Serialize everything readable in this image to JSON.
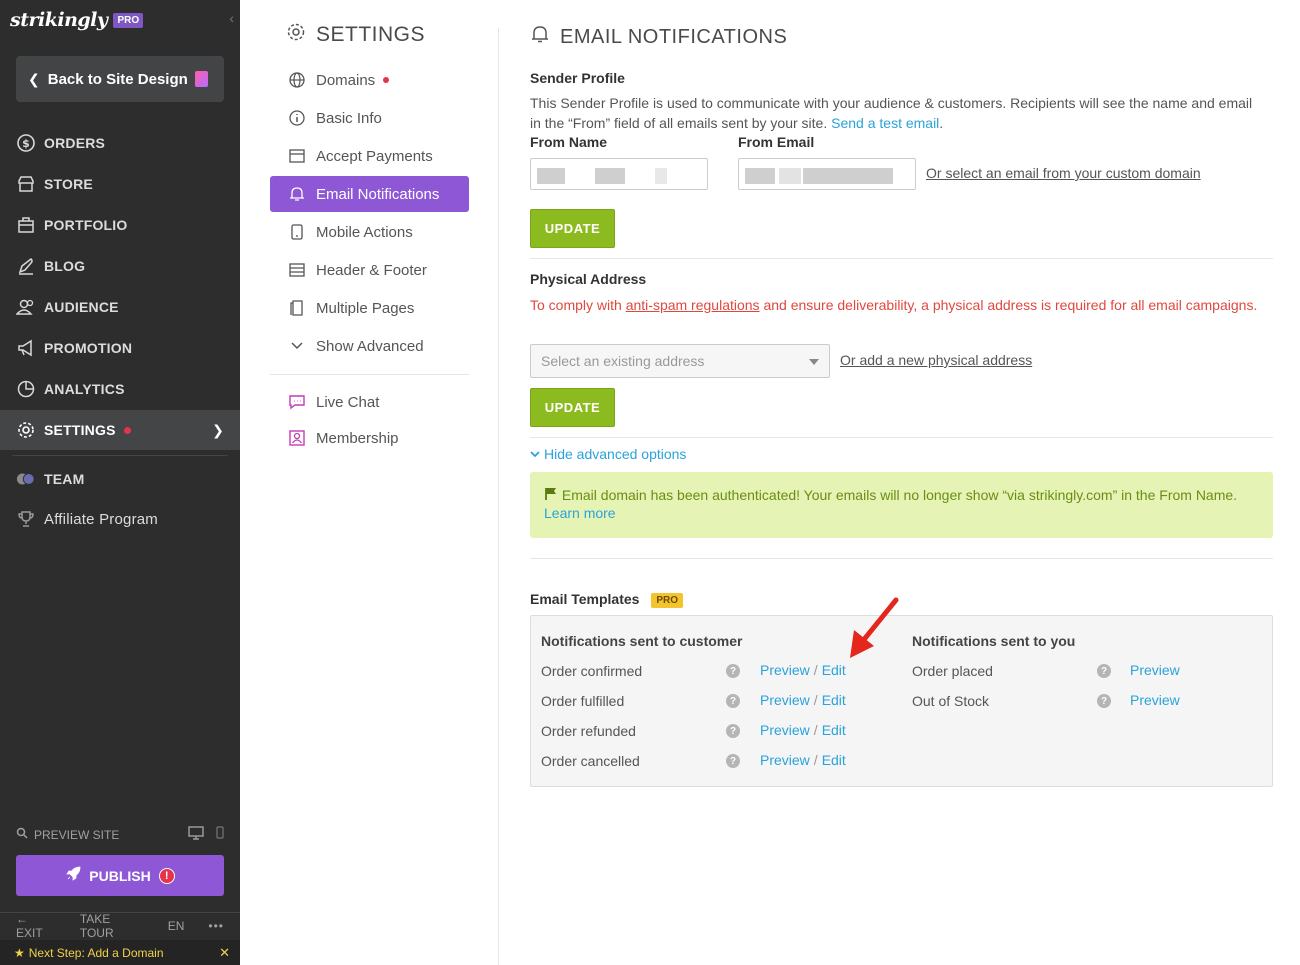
{
  "brand": {
    "logo": "strikingly",
    "badge": "PRO"
  },
  "sidebar": {
    "back_label": "Back to Site Design",
    "items": [
      {
        "label": "ORDERS",
        "icon": "dollar-circle-icon"
      },
      {
        "label": "STORE",
        "icon": "store-icon"
      },
      {
        "label": "PORTFOLIO",
        "icon": "portfolio-icon"
      },
      {
        "label": "BLOG",
        "icon": "pen-icon"
      },
      {
        "label": "AUDIENCE",
        "icon": "audience-icon"
      },
      {
        "label": "PROMOTION",
        "icon": "megaphone-icon"
      },
      {
        "label": "ANALYTICS",
        "icon": "pie-chart-icon"
      },
      {
        "label": "SETTINGS",
        "icon": "gear-icon"
      }
    ],
    "team_label": "TEAM",
    "affiliate_label": "Affiliate Program",
    "preview_label": "PREVIEW SITE",
    "publish_label": "PUBLISH",
    "bottom": {
      "exit": "EXIT",
      "tour": "TAKE TOUR",
      "lang": "EN",
      "more": "•••"
    },
    "next_step": "Next Step: Add a Domain"
  },
  "settings_nav": {
    "title": "SETTINGS",
    "items": [
      {
        "label": "Domains",
        "icon": "globe-icon"
      },
      {
        "label": "Basic Info",
        "icon": "info-icon"
      },
      {
        "label": "Accept Payments",
        "icon": "payment-icon"
      },
      {
        "label": "Email Notifications",
        "icon": "bell-icon"
      },
      {
        "label": "Mobile Actions",
        "icon": "mobile-icon"
      },
      {
        "label": "Header & Footer",
        "icon": "header-footer-icon"
      },
      {
        "label": "Multiple Pages",
        "icon": "pages-icon"
      },
      {
        "label": "Show Advanced",
        "icon": "chevron-down-icon"
      }
    ],
    "extra": [
      {
        "label": "Live Chat",
        "icon": "chat-icon"
      },
      {
        "label": "Membership",
        "icon": "membership-icon"
      }
    ]
  },
  "main": {
    "title": "EMAIL NOTIFICATIONS",
    "sender": {
      "heading": "Sender Profile",
      "desc": "This Sender Profile is used to communicate with your audience & customers. Recipients will see the name and email in the “From” field of all emails sent by your site.",
      "test_link": "Send a test email",
      "from_name_label": "From Name",
      "from_email_label": "From Email",
      "custom_domain_link": "Or select an email from your custom domain",
      "update": "UPDATE"
    },
    "address": {
      "heading": "Physical Address",
      "warn_pre": "To comply with",
      "warn_link": "anti-spam regulations",
      "warn_post": "and ensure deliverability, a physical address is required for all email campaigns.",
      "select_placeholder": "Select an existing address",
      "add_link": "Or add a new physical address",
      "update": "UPDATE"
    },
    "hide_advanced": "Hide advanced options",
    "auth_msg": "Email domain has been authenticated! Your emails will no longer show “via strikingly.com” in the From Name.",
    "learn_more": "Learn more",
    "templates": {
      "heading": "Email Templates",
      "badge": "PRO",
      "customer_head": "Notifications sent to customer",
      "you_head": "Notifications sent to you",
      "customer_rows": [
        "Order confirmed",
        "Order fulfilled",
        "Order refunded",
        "Order cancelled"
      ],
      "you_rows": [
        "Order placed",
        "Out of Stock"
      ],
      "preview": "Preview",
      "edit": "Edit",
      "help": "?"
    }
  },
  "colors": {
    "accent": "#8e57d6",
    "link": "#2aa3d9",
    "update": "#8cbb1f",
    "warn": "#e0483e",
    "success_bg": "#e5f3b5"
  }
}
